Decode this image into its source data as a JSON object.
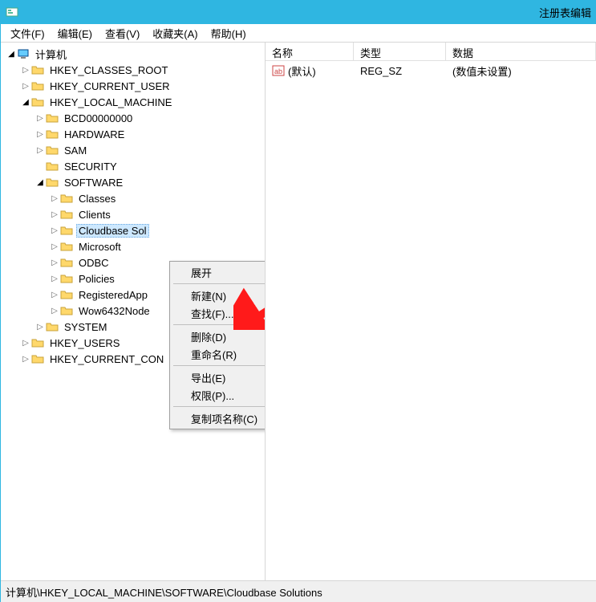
{
  "title": "注册表编辑",
  "menu": [
    "文件(F)",
    "编辑(E)",
    "查看(V)",
    "收藏夹(A)",
    "帮助(H)"
  ],
  "tree": {
    "root": "计算机",
    "hives": [
      "HKEY_CLASSES_ROOT",
      "HKEY_CURRENT_USER",
      "HKEY_LOCAL_MACHINE",
      "HKEY_USERS",
      "HKEY_CURRENT_CON"
    ],
    "hklm": [
      "BCD00000000",
      "HARDWARE",
      "SAM",
      "SECURITY",
      "SOFTWARE",
      "SYSTEM"
    ],
    "software": [
      "Classes",
      "Clients",
      "Cloudbase Sol",
      "Microsoft",
      "ODBC",
      "Policies",
      "RegisteredApp",
      "Wow6432Node"
    ]
  },
  "list": {
    "headers": [
      "名称",
      "类型",
      "数据"
    ],
    "rows": [
      {
        "name": "(默认)",
        "type": "REG_SZ",
        "data": "(数值未设置)"
      }
    ]
  },
  "context": [
    "展开",
    "新建(N)",
    "查找(F)...",
    "删除(D)",
    "重命名(R)",
    "导出(E)",
    "权限(P)...",
    "复制项名称(C)"
  ],
  "status": "计算机\\HKEY_LOCAL_MACHINE\\SOFTWARE\\Cloudbase Solutions"
}
